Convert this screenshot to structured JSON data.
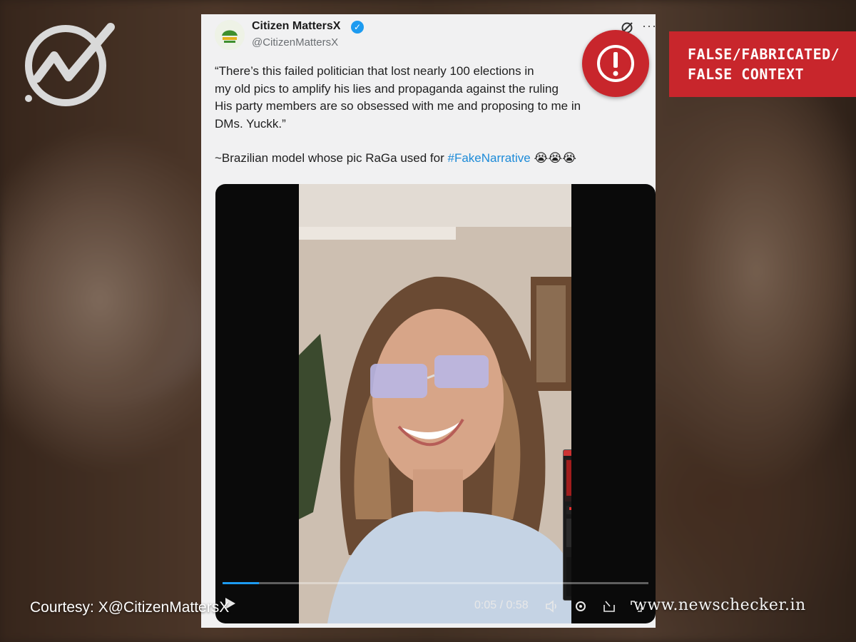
{
  "tweet": {
    "display_name": "Citizen MattersX",
    "handle": "@CitizenMattersX",
    "text_lines": [
      "“There’s this failed politician that lost nearly 100 elections in",
      "my old pics to amplify his lies and propaganda against the ruling",
      "His party members are so obsessed with me and proposing to me in",
      "DMs. Yuckk.”"
    ],
    "attribution_prefix": "~Brazilian model whose pic RaGa used for ",
    "hashtag": "#FakeNarrative",
    "emojis": "😭😭😭",
    "icons": {
      "verified": "verified-badge-icon",
      "grok": "grok-icon",
      "more": "more-options-icon"
    }
  },
  "video": {
    "elapsed": "0:05",
    "duration": "0:58",
    "time_display": "0:05 / 0:58",
    "progress_fraction": 0.086,
    "icons": [
      "play-icon",
      "volume-icon",
      "settings-icon",
      "pip-icon",
      "fullscreen-icon"
    ]
  },
  "verdict": {
    "line1": "FALSE/FABRICATED/",
    "line2": "FALSE CONTEXT",
    "color": "#c8262c"
  },
  "courtesy": "Courtesy: X@CitizenMattersX",
  "site_url": "www.newschecker.in",
  "colors": {
    "verdict_red": "#c8262c",
    "hashtag_blue": "#1d8bd8",
    "card_bg": "#f1f1f2"
  }
}
